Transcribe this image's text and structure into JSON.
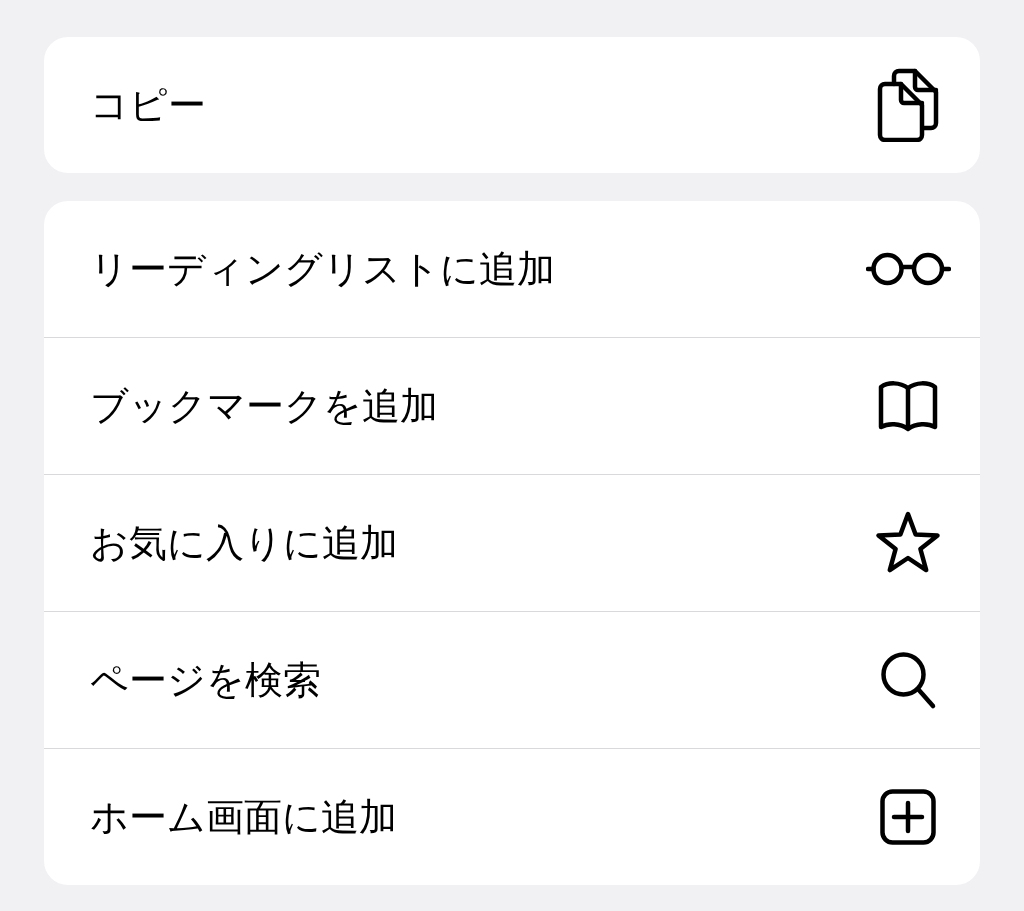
{
  "groups": [
    {
      "items": [
        {
          "label": "コピー",
          "kind": "copy"
        }
      ]
    },
    {
      "items": [
        {
          "label": "リーディングリストに追加",
          "kind": "glasses"
        },
        {
          "label": "ブックマークを追加",
          "kind": "book"
        },
        {
          "label": "お気に入りに追加",
          "kind": "star"
        },
        {
          "label": "ページを検索",
          "kind": "search"
        },
        {
          "label": "ホーム画面に追加",
          "kind": "plus-square"
        }
      ]
    }
  ]
}
